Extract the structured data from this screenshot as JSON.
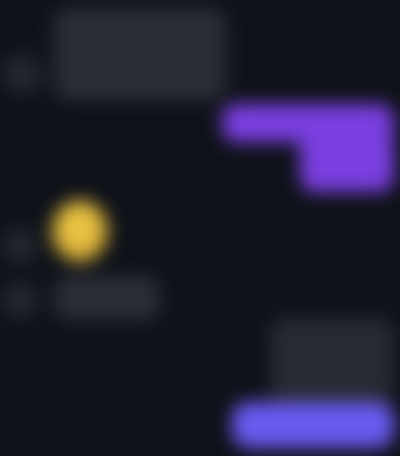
{
  "conversation": {
    "messages": [
      {
        "side": "incoming",
        "kind": "text",
        "text": ""
      },
      {
        "side": "outgoing",
        "kind": "text",
        "text": ""
      },
      {
        "side": "incoming",
        "kind": "sticker",
        "text": ""
      },
      {
        "side": "incoming",
        "kind": "text",
        "text": ""
      },
      {
        "side": "outgoing",
        "kind": "media",
        "text": ""
      },
      {
        "side": "outgoing",
        "kind": "text",
        "text": ""
      }
    ]
  },
  "colors": {
    "background": "#0f121a",
    "incoming_bubble": "#2b2e36",
    "outgoing_bubble": "#7a3fe0",
    "outgoing_accent": "#6a5af0",
    "sticker": "#e0b83e"
  }
}
